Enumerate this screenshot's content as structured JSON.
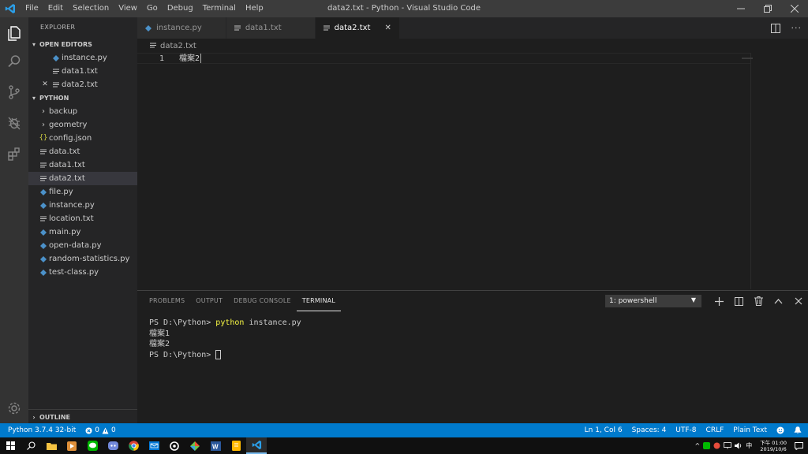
{
  "window": {
    "title": "data2.txt - Python - Visual Studio Code",
    "menu": [
      "File",
      "Edit",
      "Selection",
      "View",
      "Go",
      "Debug",
      "Terminal",
      "Help"
    ]
  },
  "sidebar": {
    "title": "EXPLORER",
    "open_editors": {
      "label": "OPEN EDITORS",
      "items": [
        {
          "name": "instance.py",
          "type": "py"
        },
        {
          "name": "data1.txt",
          "type": "txt"
        },
        {
          "name": "data2.txt",
          "type": "txt",
          "close": "✕"
        }
      ]
    },
    "folder": {
      "label": "PYTHON",
      "items": [
        {
          "name": "backup",
          "type": "folder"
        },
        {
          "name": "geometry",
          "type": "folder"
        },
        {
          "name": "config.json",
          "type": "json"
        },
        {
          "name": "data.txt",
          "type": "txt"
        },
        {
          "name": "data1.txt",
          "type": "txt"
        },
        {
          "name": "data2.txt",
          "type": "txt"
        },
        {
          "name": "file.py",
          "type": "py"
        },
        {
          "name": "instance.py",
          "type": "py"
        },
        {
          "name": "location.txt",
          "type": "txt"
        },
        {
          "name": "main.py",
          "type": "py"
        },
        {
          "name": "open-data.py",
          "type": "py"
        },
        {
          "name": "random-statistics.py",
          "type": "py"
        },
        {
          "name": "test-class.py",
          "type": "py"
        }
      ]
    },
    "outline": "OUTLINE"
  },
  "tabs": [
    {
      "label": "instance.py",
      "type": "py"
    },
    {
      "label": "data1.txt",
      "type": "txt"
    },
    {
      "label": "data2.txt",
      "type": "txt",
      "active": true
    }
  ],
  "breadcrumb": "data2.txt",
  "editor": {
    "line_number": "1",
    "content": "檔案2"
  },
  "panel": {
    "tabs": [
      "PROBLEMS",
      "OUTPUT",
      "DEBUG CONSOLE",
      "TERMINAL"
    ],
    "active_tab": "TERMINAL",
    "terminal_select": "1: powershell",
    "terminal": {
      "prompt": "PS D:\\Python> ",
      "command": "python",
      "args": " instance.py",
      "output1": "檔案1",
      "output2": "檔案2",
      "prompt2": "PS D:\\Python> "
    }
  },
  "statusbar": {
    "python": "Python 3.7.4 32-bit",
    "errors": "0",
    "warnings": "0",
    "position": "Ln 1, Col 6",
    "spaces": "Spaces: 4",
    "encoding": "UTF-8",
    "eol": "CRLF",
    "language": "Plain Text"
  },
  "taskbar": {
    "time_period": "下午 01:00",
    "date": "2019/10/6"
  },
  "colors": {
    "accent": "#007acc",
    "py_icon": "#4b91c9",
    "json_icon": "#cbcb41",
    "txt_icon": "#c5c5c5"
  }
}
